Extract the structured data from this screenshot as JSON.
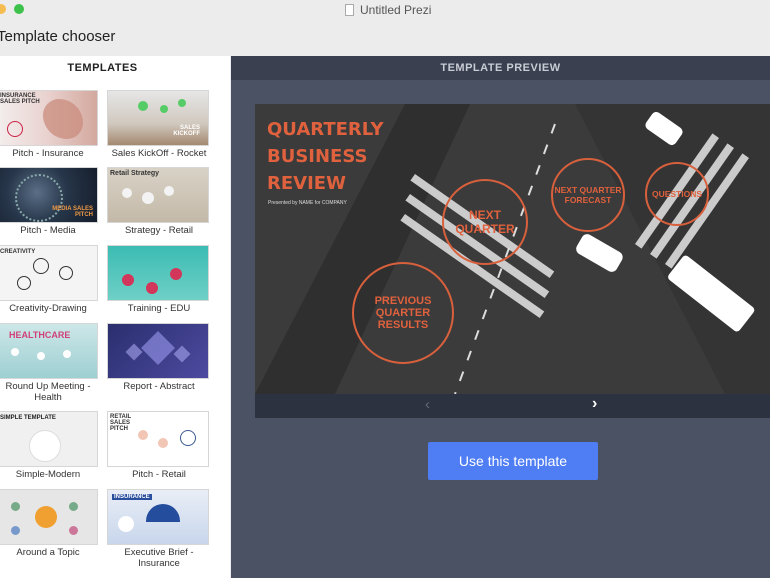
{
  "window": {
    "doc_title": "Untitled Prezi",
    "chooser_title": "Template chooser"
  },
  "templates_header": "TEMPLATES",
  "preview_header": "TEMPLATE PREVIEW",
  "templates": [
    {
      "label": "Pitch - Insurance",
      "thumb_text": "INSURANCE\nSALES PITCH"
    },
    {
      "label": "Sales KickOff - Rocket",
      "thumb_text": "SALES\nKICKOFF"
    },
    {
      "label": "Pitch - Media",
      "thumb_text": "MEDIA SALES\nPITCH"
    },
    {
      "label": "Strategy - Retail",
      "thumb_text": "Retail Strategy"
    },
    {
      "label": "Creativity-Drawing",
      "thumb_text": "CREATIVITY"
    },
    {
      "label": "Training - EDU",
      "thumb_text": ""
    },
    {
      "label": "Round Up Meeting - Health",
      "thumb_text": "HEALTHCARE"
    },
    {
      "label": "Report - Abstract",
      "thumb_text": ""
    },
    {
      "label": "Simple-Modern",
      "thumb_text": "SIMPLE TEMPLATE"
    },
    {
      "label": "Pitch - Retail",
      "thumb_text": "RETAIL\nSALES\nPITCH"
    },
    {
      "label": "Around a Topic",
      "thumb_text": ""
    },
    {
      "label": "Executive Brief - Insurance",
      "thumb_text": "INSURANCE"
    }
  ],
  "preview": {
    "title_lines": [
      "QUARTERLY",
      "BUSINESS",
      "REVIEW"
    ],
    "subtitle": "Presented by NAME for COMPANY",
    "circles": [
      "NEXT QUARTER",
      "NEXT QUARTER FORECAST",
      "QUESTIONS",
      "PREVIOUS QUARTER RESULTS"
    ],
    "nav_prev": "‹",
    "nav_next": "›"
  },
  "use_button": "Use this template",
  "colors": {
    "accent": "#4f7df3",
    "preview_orange": "#e0613d",
    "panel_dark": "#4b5263"
  }
}
